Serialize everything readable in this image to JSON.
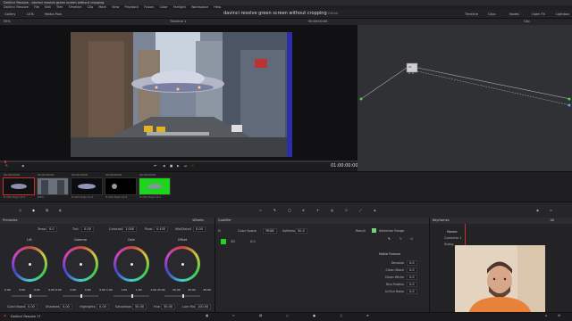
{
  "window": {
    "title": "DaVinci Resolve - davinci resolve green screen without cropping"
  },
  "menu": [
    "DaVinci Resolve",
    "File",
    "Edit",
    "Trim",
    "Timeline",
    "Clip",
    "Mark",
    "View",
    "Playback",
    "Fusion",
    "Color",
    "Fairlight",
    "Workspace",
    "Help"
  ],
  "toolbar": {
    "gallery": "Gallery",
    "lut": "LUTs",
    "media_pool": "Media Pool",
    "timeline": "Timeline",
    "clips": "Clips",
    "nodes": "Nodes",
    "openfx": "Open FX",
    "lightbox": "Lightbox"
  },
  "project": {
    "title": "davinci resolve green screen without cropping",
    "status": "Edited"
  },
  "viewer": {
    "zoom": "55%",
    "timeline_name": "Timeline 1",
    "source_tc": "00:00:00:00",
    "current_tc": "01:00:00:00"
  },
  "nodes": {
    "mode": "Clip",
    "node_label": "01"
  },
  "clips": [
    {
      "tc": "00:00:00:00",
      "codec": "H.264 High L5.0",
      "num": "01"
    },
    {
      "tc": "00:00:00:00",
      "codec": "JPEG",
      "num": "02"
    },
    {
      "tc": "00:00:00:00",
      "codec": "H.264 High L5.0",
      "num": "03"
    },
    {
      "tc": "00:00:00:00",
      "codec": "H.264 High L5.0",
      "num": "04"
    },
    {
      "tc": "00:00:00:00",
      "codec": "H.264 High L5.0",
      "num": "05"
    }
  ],
  "primaries": {
    "title": "Primaries",
    "mode": "Wheels",
    "temp": {
      "label": "Temp",
      "value": "0.0"
    },
    "tint": {
      "label": "Tint",
      "value": "0.00"
    },
    "contrast": {
      "label": "Contrast",
      "value": "1.000"
    },
    "pivot": {
      "label": "Pivot",
      "value": "0.435"
    },
    "md": {
      "label": "Mid/Detail",
      "value": "0.00"
    },
    "wheels": [
      {
        "label": "Lift",
        "values": [
          "0.00",
          "0.00",
          "0.00",
          "0.00"
        ]
      },
      {
        "label": "Gamma",
        "values": [
          "0.00",
          "0.00",
          "0.00",
          "0.00"
        ]
      },
      {
        "label": "Gain",
        "values": [
          "1.00",
          "1.00",
          "1.00",
          "1.00"
        ]
      },
      {
        "label": "Offset",
        "values": [
          "25.00",
          "25.00",
          "25.00",
          "25.00"
        ]
      }
    ],
    "footer": {
      "color_boost": {
        "label": "Color Boost",
        "value": "0.00"
      },
      "shadows": {
        "label": "Shadows",
        "value": "0.00"
      },
      "highlights": {
        "label": "Highlights",
        "value": "0.00"
      },
      "saturation": {
        "label": "Saturation",
        "value": "50.00"
      },
      "hue": {
        "label": "Hue",
        "value": "50.00"
      },
      "lum_mix": {
        "label": "Lum Mix",
        "value": "100.00"
      }
    }
  },
  "qualifier": {
    "title": "Qualifier",
    "picker_label": "Selection Range",
    "color_space_label": "Color Space",
    "color_space": "YRGB",
    "softness_label": "Softness",
    "softness": "50.0",
    "swatch_label": "3D",
    "swatch_value": "0.0",
    "result_label": "Result",
    "matte_title": "Matte Finesse",
    "matte": [
      {
        "label": "Denoise",
        "value": "0.0"
      },
      {
        "label": "Clean Black",
        "value": "0.0"
      },
      {
        "label": "Clean White",
        "value": "0.0"
      },
      {
        "label": "Blur Radius",
        "value": "0.0"
      },
      {
        "label": "In/Out Ratio",
        "value": "0.0"
      }
    ]
  },
  "keyframes": {
    "title": "Keyframes",
    "filter": "All",
    "master": "Master",
    "tracks": [
      "Corrector 1",
      "Sizing"
    ]
  },
  "status": {
    "app": "DaVinci Resolve 17"
  },
  "colors": {
    "accent": "#d12b2b",
    "green_clip": "#1fd41f",
    "panel": "#262629"
  }
}
